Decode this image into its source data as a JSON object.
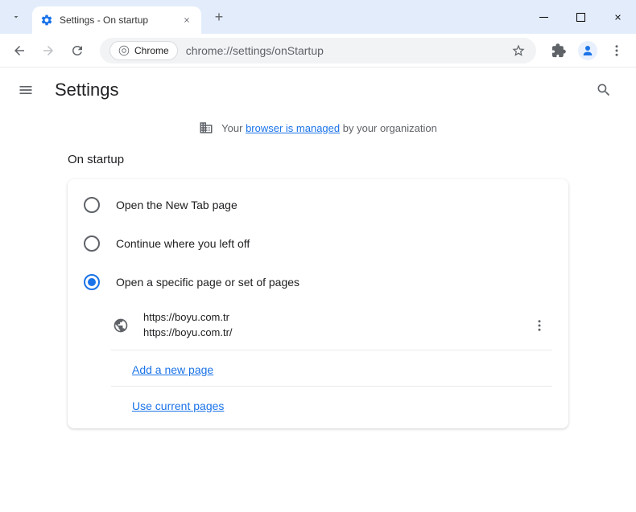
{
  "window": {
    "tab_title": "Settings - On startup"
  },
  "toolbar": {
    "chrome_label": "Chrome",
    "url": "chrome://settings/onStartup"
  },
  "header": {
    "title": "Settings"
  },
  "managed": {
    "prefix": "Your",
    "link": "browser is managed",
    "suffix": "by your organization"
  },
  "section": {
    "title": "On startup"
  },
  "options": {
    "new_tab": "Open the New Tab page",
    "continue": "Continue where you left off",
    "specific": "Open a specific page or set of pages"
  },
  "pages": [
    {
      "title": "https://boyu.com.tr",
      "url": "https://boyu.com.tr/"
    }
  ],
  "actions": {
    "add_page": "Add a new page",
    "use_current": "Use current pages"
  }
}
